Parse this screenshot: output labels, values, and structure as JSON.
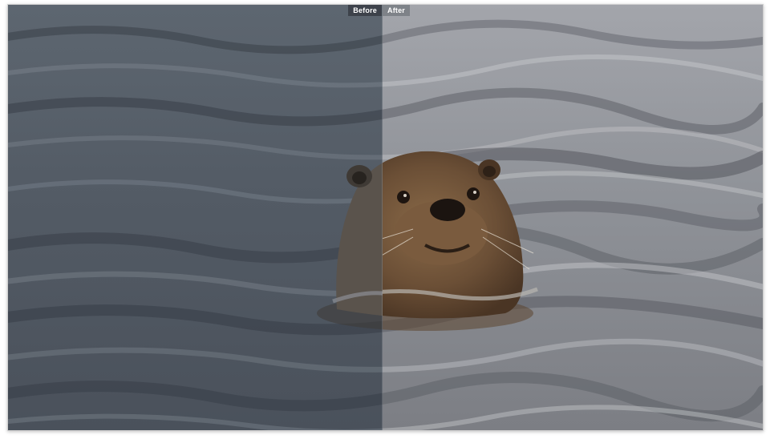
{
  "compare": {
    "before_label": "Before",
    "after_label": "After"
  },
  "photo": {
    "subject": "otter-in-water"
  },
  "colors": {
    "water_after": "#8e9097",
    "water_before": "#4f5660",
    "otter_fur": "#6b4f36",
    "otter_dark": "#3a2a1d"
  }
}
